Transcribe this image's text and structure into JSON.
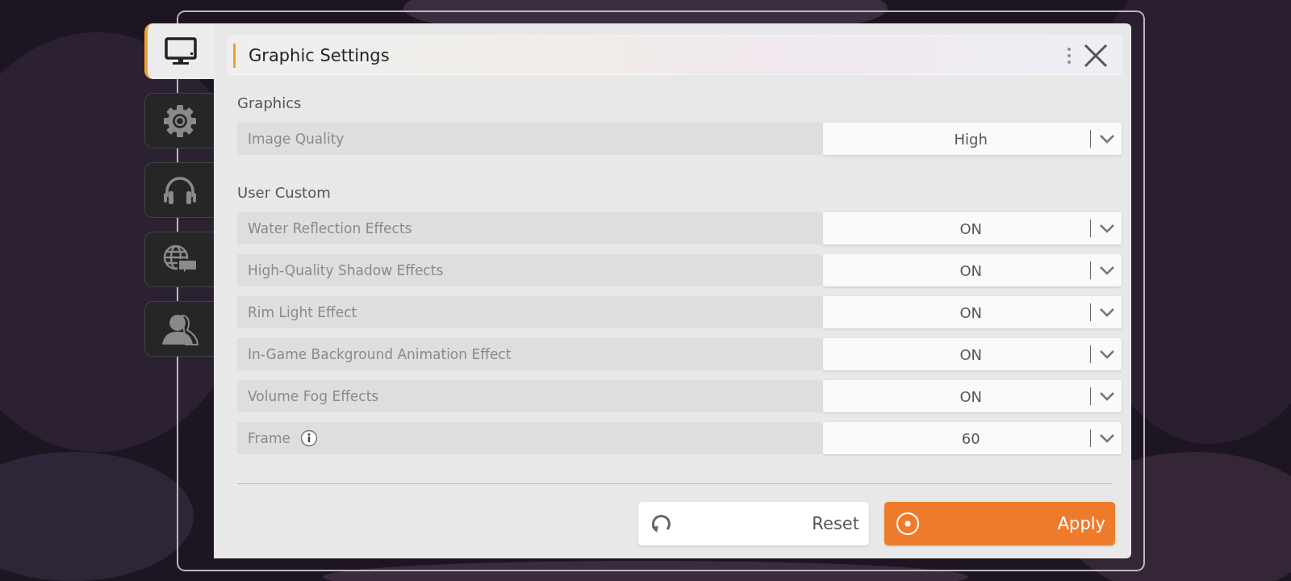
{
  "sidebar": {
    "tabs": [
      {
        "kind": "monitor",
        "selected": true
      },
      {
        "kind": "gear",
        "selected": false
      },
      {
        "kind": "headphones",
        "selected": false
      },
      {
        "kind": "globe-chat",
        "selected": false
      },
      {
        "kind": "person",
        "selected": false
      }
    ]
  },
  "panel": {
    "title": "Graphic Settings",
    "sections": [
      {
        "heading": "Graphics",
        "rows": [
          {
            "label": "Image Quality",
            "value": "High",
            "info": false
          }
        ]
      },
      {
        "heading": "User Custom",
        "rows": [
          {
            "label": "Water Reflection Effects",
            "value": "ON",
            "info": false
          },
          {
            "label": "High-Quality Shadow Effects",
            "value": "ON",
            "info": false
          },
          {
            "label": "Rim Light Effect",
            "value": "ON",
            "info": false
          },
          {
            "label": "In-Game Background Animation Effect",
            "value": "ON",
            "info": false
          },
          {
            "label": "Volume Fog Effects",
            "value": "ON",
            "info": false
          },
          {
            "label": "Frame",
            "value": "60",
            "info": true
          }
        ]
      }
    ],
    "buttons": [
      {
        "kind": "reset",
        "label": "Reset"
      },
      {
        "kind": "apply",
        "label": "Apply"
      }
    ]
  }
}
